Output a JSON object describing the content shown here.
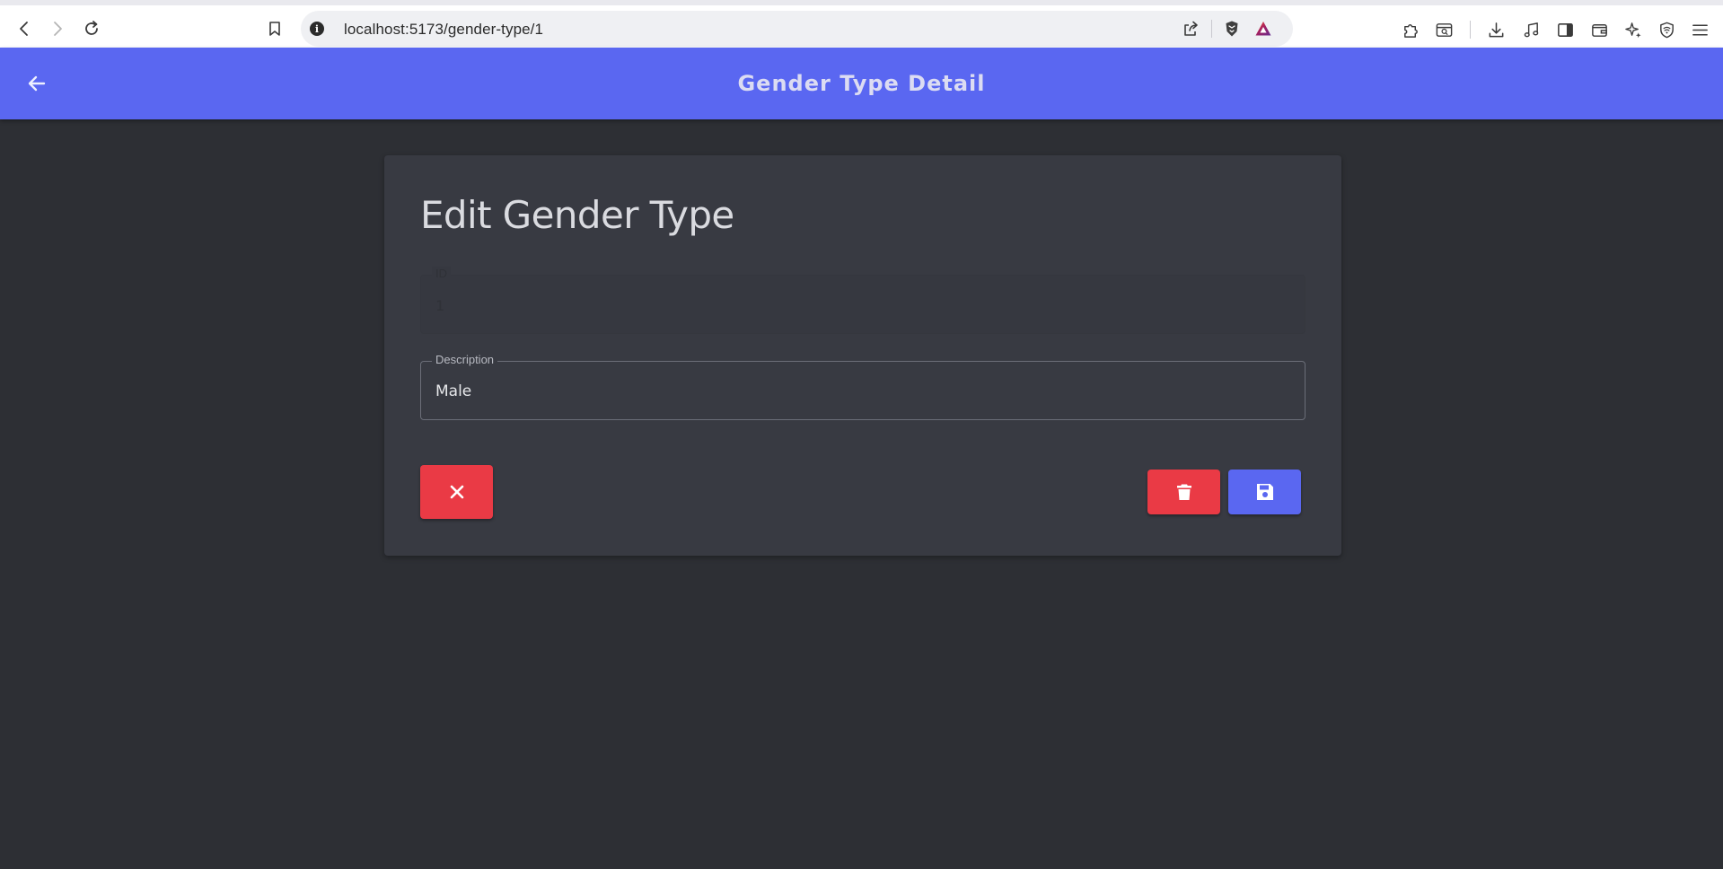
{
  "browser": {
    "url": "localhost:5173/gender-type/1",
    "info_glyph": "i",
    "icons": {
      "back": "arrow-left-icon",
      "forward": "arrow-right-icon",
      "reload": "reload-icon",
      "bookmark": "bookmark-icon",
      "share": "share-icon",
      "brave_shield": "lion-shield-icon",
      "rewards": "triangle-icon",
      "extensions": "puzzle-icon",
      "tab_search": "tab-search-icon",
      "downloads": "download-icon",
      "media": "music-note-icon",
      "sidebar": "sidebar-icon",
      "wallet": "wallet-icon",
      "leo": "sparkle-icon",
      "vpn": "vpn-shield-icon",
      "menu": "hamburger-menu-icon"
    }
  },
  "header": {
    "title": "Gender Type Detail",
    "back_icon": "arrow-left-icon",
    "color": "#5a67f1"
  },
  "form": {
    "title": "Edit Gender Type",
    "fields": [
      {
        "label": "ID",
        "value": "1",
        "disabled": true
      },
      {
        "label": "Description",
        "value": "Male",
        "disabled": false
      }
    ],
    "buttons": {
      "cancel": {
        "icon": "close-icon",
        "color": "#ea3a45"
      },
      "delete": {
        "icon": "trash-icon",
        "color": "#ea3a45"
      },
      "save": {
        "icon": "floppy-disk-icon",
        "color": "#5a67f1"
      }
    }
  }
}
